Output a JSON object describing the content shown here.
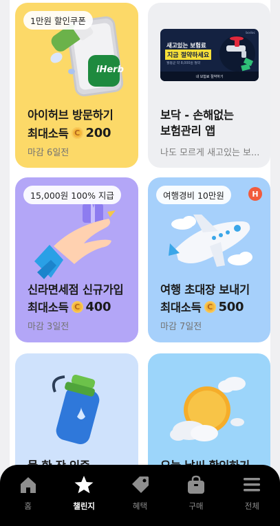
{
  "cards": [
    {
      "badge": "1만원 할인쿠폰",
      "title_line1": "아이허브 방문하기",
      "reward_prefix": "최대소득",
      "coin": "C",
      "amount": "200",
      "deadline": "마감 6일전",
      "bg": "#fcd968",
      "image_text": "iHerb"
    },
    {
      "title_line1": "보닥 - 손해없는",
      "title_line2": "보험관리 앱",
      "subtitle": "나도 모르게 새고있는 보...",
      "bg": "#eeeff2",
      "banner": {
        "line1": "새고있는 보험료",
        "line2": "지금 절약하세요",
        "small": "월평균 약 8,000원 절약",
        "button": "내 보험료 절약하기",
        "corner": "bodoc"
      }
    },
    {
      "badge": "15,000원 100% 지급",
      "title_line1": "신라면세점 신규가입",
      "reward_prefix": "최대소득",
      "coin": "C",
      "amount": "400",
      "deadline": "마감 3일전",
      "bg": "#b3a6f7"
    },
    {
      "badge": "여행경비 10만원",
      "corner_badge": "H",
      "title_line1": "여행 초대장 보내기",
      "reward_prefix": "최대소득",
      "coin": "C",
      "amount": "500",
      "deadline": "마감 7일전",
      "bg": "#a6d0fb"
    },
    {
      "title_line1": "물 한 잔 인증",
      "bg": "#cfe2fc"
    },
    {
      "title_line1": "오늘 날씨 확인하기",
      "bg": "#9cd5fa"
    }
  ],
  "nav": [
    {
      "label": "홈",
      "icon": "home-icon",
      "active": false
    },
    {
      "label": "챌린지",
      "icon": "star-icon",
      "active": true
    },
    {
      "label": "혜택",
      "icon": "tag-icon",
      "active": false
    },
    {
      "label": "구매",
      "icon": "shopping-bag-icon",
      "active": false
    },
    {
      "label": "전체",
      "icon": "menu-icon",
      "active": false
    }
  ]
}
